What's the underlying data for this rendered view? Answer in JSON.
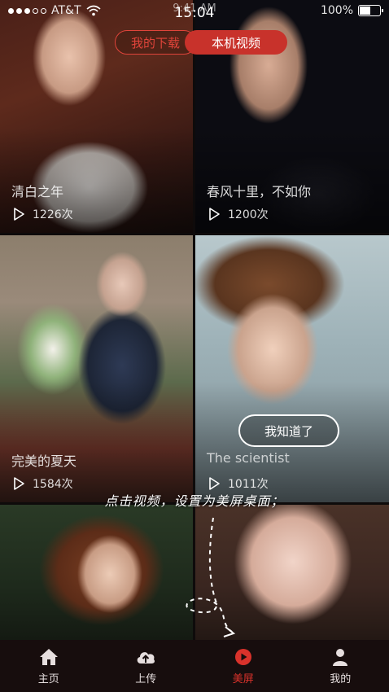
{
  "status_bar": {
    "carrier": "AT&T",
    "time_small": "9:41 AM",
    "time": "15:04",
    "battery": "100%",
    "battery_level": 0.6
  },
  "tabs": [
    {
      "label": "我的下载",
      "active": false
    },
    {
      "label": "本机视频",
      "active": true
    }
  ],
  "videos": [
    {
      "title": "清白之年",
      "plays": "1226次"
    },
    {
      "title": "春风十里，不如你",
      "plays": "1200次"
    },
    {
      "title": "完美的夏天",
      "plays": "1584次"
    },
    {
      "title": "The scientist",
      "plays": "1011次"
    },
    {
      "title": "",
      "plays": ""
    },
    {
      "title": "",
      "plays": ""
    }
  ],
  "guide": {
    "button_label": "我知道了",
    "instruction": "点击视频，设置为美屏桌面；"
  },
  "bottom_nav": [
    {
      "label": "主页",
      "icon": "home-icon",
      "active": false
    },
    {
      "label": "上传",
      "icon": "cloud-upload-icon",
      "active": false
    },
    {
      "label": "美屏",
      "icon": "play-circle-icon",
      "active": true
    },
    {
      "label": "我的",
      "icon": "user-icon",
      "active": false
    }
  ],
  "colors": {
    "accent": "#d9322b",
    "nav_bg": "#170d0d"
  }
}
